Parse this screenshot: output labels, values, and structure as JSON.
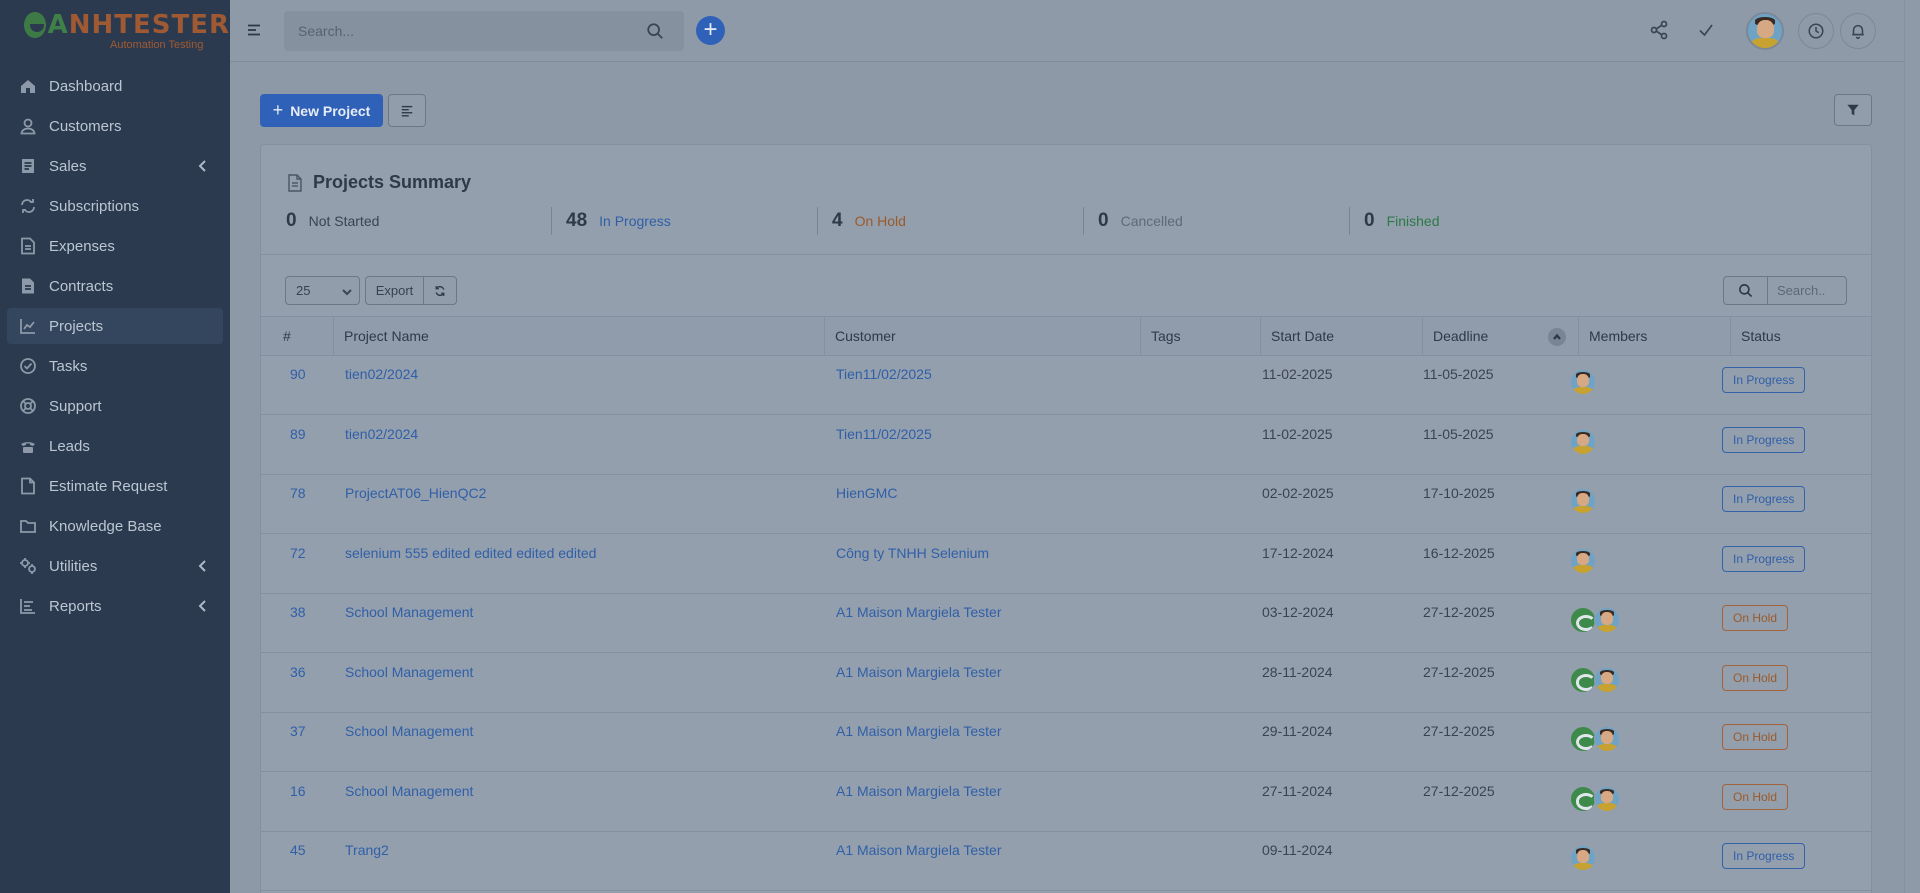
{
  "brand": {
    "name_a": "A",
    "name_rest": "NHTESTER",
    "tagline": "Automation Testing"
  },
  "sidebar": {
    "items": [
      {
        "label": "Dashboard",
        "icon": "home-icon",
        "chevron": false,
        "active": false
      },
      {
        "label": "Customers",
        "icon": "user-icon",
        "chevron": false,
        "active": false
      },
      {
        "label": "Sales",
        "icon": "receipt-icon",
        "chevron": true,
        "active": false
      },
      {
        "label": "Subscriptions",
        "icon": "repeat-icon",
        "chevron": false,
        "active": false
      },
      {
        "label": "Expenses",
        "icon": "file-text-icon",
        "chevron": false,
        "active": false
      },
      {
        "label": "Contracts",
        "icon": "file-icon",
        "chevron": false,
        "active": false
      },
      {
        "label": "Projects",
        "icon": "chart-icon",
        "chevron": false,
        "active": true
      },
      {
        "label": "Tasks",
        "icon": "check-circle-icon",
        "chevron": false,
        "active": false
      },
      {
        "label": "Support",
        "icon": "life-buoy-icon",
        "chevron": false,
        "active": false
      },
      {
        "label": "Leads",
        "icon": "phone-icon",
        "chevron": false,
        "active": false
      },
      {
        "label": "Estimate Request",
        "icon": "document-icon",
        "chevron": false,
        "active": false
      },
      {
        "label": "Knowledge Base",
        "icon": "folder-icon",
        "chevron": false,
        "active": false
      },
      {
        "label": "Utilities",
        "icon": "cogs-icon",
        "chevron": true,
        "active": false
      },
      {
        "label": "Reports",
        "icon": "bar-chart-icon",
        "chevron": true,
        "active": false
      }
    ]
  },
  "topbar": {
    "search_placeholder": "Search..."
  },
  "toolbar": {
    "new_project_label": "New Project"
  },
  "summary": {
    "title": "Projects Summary",
    "stats": [
      {
        "count": "0",
        "label": "Not Started",
        "tone": "gray"
      },
      {
        "count": "48",
        "label": "In Progress",
        "tone": "blue"
      },
      {
        "count": "4",
        "label": "On Hold",
        "tone": "orange"
      },
      {
        "count": "0",
        "label": "Cancelled",
        "tone": "muted"
      },
      {
        "count": "0",
        "label": "Finished",
        "tone": "green"
      }
    ]
  },
  "table_controls": {
    "page_length": "25",
    "export_label": "Export",
    "search_placeholder": "Search.."
  },
  "table": {
    "columns": [
      "#",
      "Project Name",
      "Customer",
      "Tags",
      "Start Date",
      "Deadline",
      "Members",
      "Status"
    ],
    "rows": [
      {
        "id": "90",
        "name": "tien02/2024",
        "customer": "Tien11/02/2025",
        "tags": "",
        "start": "11-02-2025",
        "deadline": "11-05-2025",
        "members": [
          "person"
        ],
        "status": "In Progress"
      },
      {
        "id": "89",
        "name": "tien02/2024",
        "customer": "Tien11/02/2025",
        "tags": "",
        "start": "11-02-2025",
        "deadline": "11-05-2025",
        "members": [
          "person"
        ],
        "status": "In Progress"
      },
      {
        "id": "78",
        "name": "ProjectAT06_HienQC2",
        "customer": "HienGMC",
        "tags": "",
        "start": "02-02-2025",
        "deadline": "17-10-2025",
        "members": [
          "person"
        ],
        "status": "In Progress"
      },
      {
        "id": "72",
        "name": "selenium 555 edited edited edited edited",
        "customer": "Công ty TNHH Selenium",
        "tags": "",
        "start": "17-12-2024",
        "deadline": "16-12-2025",
        "members": [
          "person"
        ],
        "status": "In Progress"
      },
      {
        "id": "38",
        "name": "School Management",
        "customer": "A1 Maison Margiela Tester",
        "tags": "",
        "start": "03-12-2024",
        "deadline": "27-12-2025",
        "members": [
          "logo",
          "person"
        ],
        "status": "On Hold"
      },
      {
        "id": "36",
        "name": "School Management",
        "customer": "A1 Maison Margiela Tester",
        "tags": "",
        "start": "28-11-2024",
        "deadline": "27-12-2025",
        "members": [
          "logo",
          "person"
        ],
        "status": "On Hold"
      },
      {
        "id": "37",
        "name": "School Management",
        "customer": "A1 Maison Margiela Tester",
        "tags": "",
        "start": "29-11-2024",
        "deadline": "27-12-2025",
        "members": [
          "logo",
          "person"
        ],
        "status": "On Hold"
      },
      {
        "id": "16",
        "name": "School Management",
        "customer": "A1 Maison Margiela Tester",
        "tags": "",
        "start": "27-11-2024",
        "deadline": "27-12-2025",
        "members": [
          "logo",
          "person"
        ],
        "status": "On Hold"
      },
      {
        "id": "45",
        "name": "Trang2",
        "customer": "A1 Maison Margiela Tester",
        "tags": "",
        "start": "09-11-2024",
        "deadline": "",
        "members": [
          "person"
        ],
        "status": "In Progress"
      }
    ]
  },
  "colors": {
    "accent": "#3061b8",
    "sidebar_bg": "#2b3a4e",
    "in_progress": "#2f5fa8",
    "on_hold": "#9a5a2a",
    "finished": "#2b7a45"
  }
}
